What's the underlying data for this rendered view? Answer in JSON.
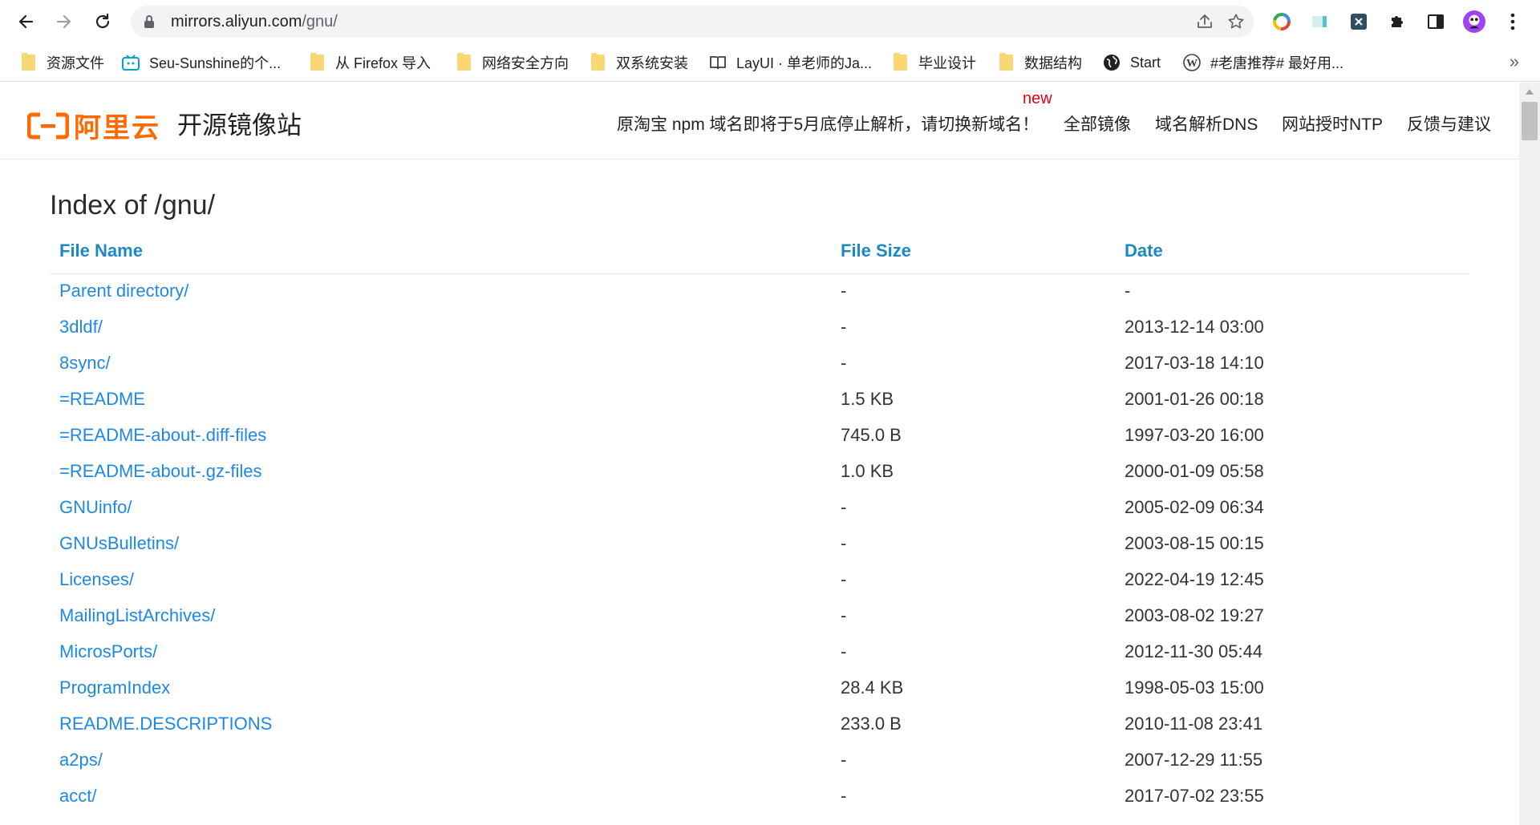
{
  "browser": {
    "url_host": "mirrors.aliyun.com",
    "url_path": "/gnu/",
    "icons": {
      "back": "back-arrow-icon",
      "forward": "forward-arrow-icon",
      "reload": "reload-icon",
      "lock": "lock-icon",
      "share": "share-icon",
      "bookmark": "star-icon",
      "extensions": [
        "google-icon",
        "tab-icon",
        "x-extension-icon",
        "puzzle-icon",
        "side-panel-icon",
        "profile-avatar-icon",
        "menu-dots-icon"
      ]
    },
    "colors": {
      "toolbar": "#ffffff",
      "omnibox": "#f1f3f4"
    }
  },
  "bookmarks": [
    {
      "label": "资源文件",
      "icon": "folder-icon"
    },
    {
      "label": "Seu-Sunshine的个...",
      "icon": "bilibili-icon"
    },
    {
      "label": "从 Firefox 导入",
      "icon": "folder-icon"
    },
    {
      "label": "网络安全方向",
      "icon": "folder-icon"
    },
    {
      "label": "双系统安装",
      "icon": "folder-icon"
    },
    {
      "label": "LayUI · 单老师的Ja...",
      "icon": "book-icon"
    },
    {
      "label": "毕业设计",
      "icon": "folder-icon"
    },
    {
      "label": "数据结构",
      "icon": "folder-icon"
    },
    {
      "label": "Start",
      "icon": "globe-icon"
    },
    {
      "label": "#老唐推荐# 最好用...",
      "icon": "wordpress-icon"
    }
  ],
  "bookmarks_more": "»",
  "site": {
    "logo_text": "阿里云",
    "title": "开源镜像站",
    "notice": "原淘宝 npm 域名即将于5月底停止解析，请切换新域名！",
    "new_badge": "new",
    "nav": [
      "全部镜像",
      "域名解析DNS",
      "网站授时NTP",
      "反馈与建议"
    ],
    "brand_color": "#ff6a00"
  },
  "listing": {
    "title": "Index of /gnu/",
    "headers": {
      "name": "File Name",
      "size": "File Size",
      "date": "Date"
    },
    "rows": [
      {
        "name": "Parent directory/",
        "size": "-",
        "date": "-"
      },
      {
        "name": "3dldf/",
        "size": "-",
        "date": "2013-12-14 03:00"
      },
      {
        "name": "8sync/",
        "size": "-",
        "date": "2017-03-18 14:10"
      },
      {
        "name": "=README",
        "size": "1.5 KB",
        "date": "2001-01-26 00:18"
      },
      {
        "name": "=README-about-.diff-files",
        "size": "745.0 B",
        "date": "1997-03-20 16:00"
      },
      {
        "name": "=README-about-.gz-files",
        "size": "1.0 KB",
        "date": "2000-01-09 05:58"
      },
      {
        "name": "GNUinfo/",
        "size": "-",
        "date": "2005-02-09 06:34"
      },
      {
        "name": "GNUsBulletins/",
        "size": "-",
        "date": "2003-08-15 00:15"
      },
      {
        "name": "Licenses/",
        "size": "-",
        "date": "2022-04-19 12:45"
      },
      {
        "name": "MailingListArchives/",
        "size": "-",
        "date": "2003-08-02 19:27"
      },
      {
        "name": "MicrosPorts/",
        "size": "-",
        "date": "2012-11-30 05:44"
      },
      {
        "name": "ProgramIndex",
        "size": "28.4 KB",
        "date": "1998-05-03 15:00"
      },
      {
        "name": "README.DESCRIPTIONS",
        "size": "233.0 B",
        "date": "2010-11-08 23:41"
      },
      {
        "name": "a2ps/",
        "size": "-",
        "date": "2007-12-29 11:55"
      },
      {
        "name": "acct/",
        "size": "-",
        "date": "2017-07-02 23:55"
      }
    ],
    "link_color": "#1e88e5",
    "header_color": "#1e88c7"
  }
}
